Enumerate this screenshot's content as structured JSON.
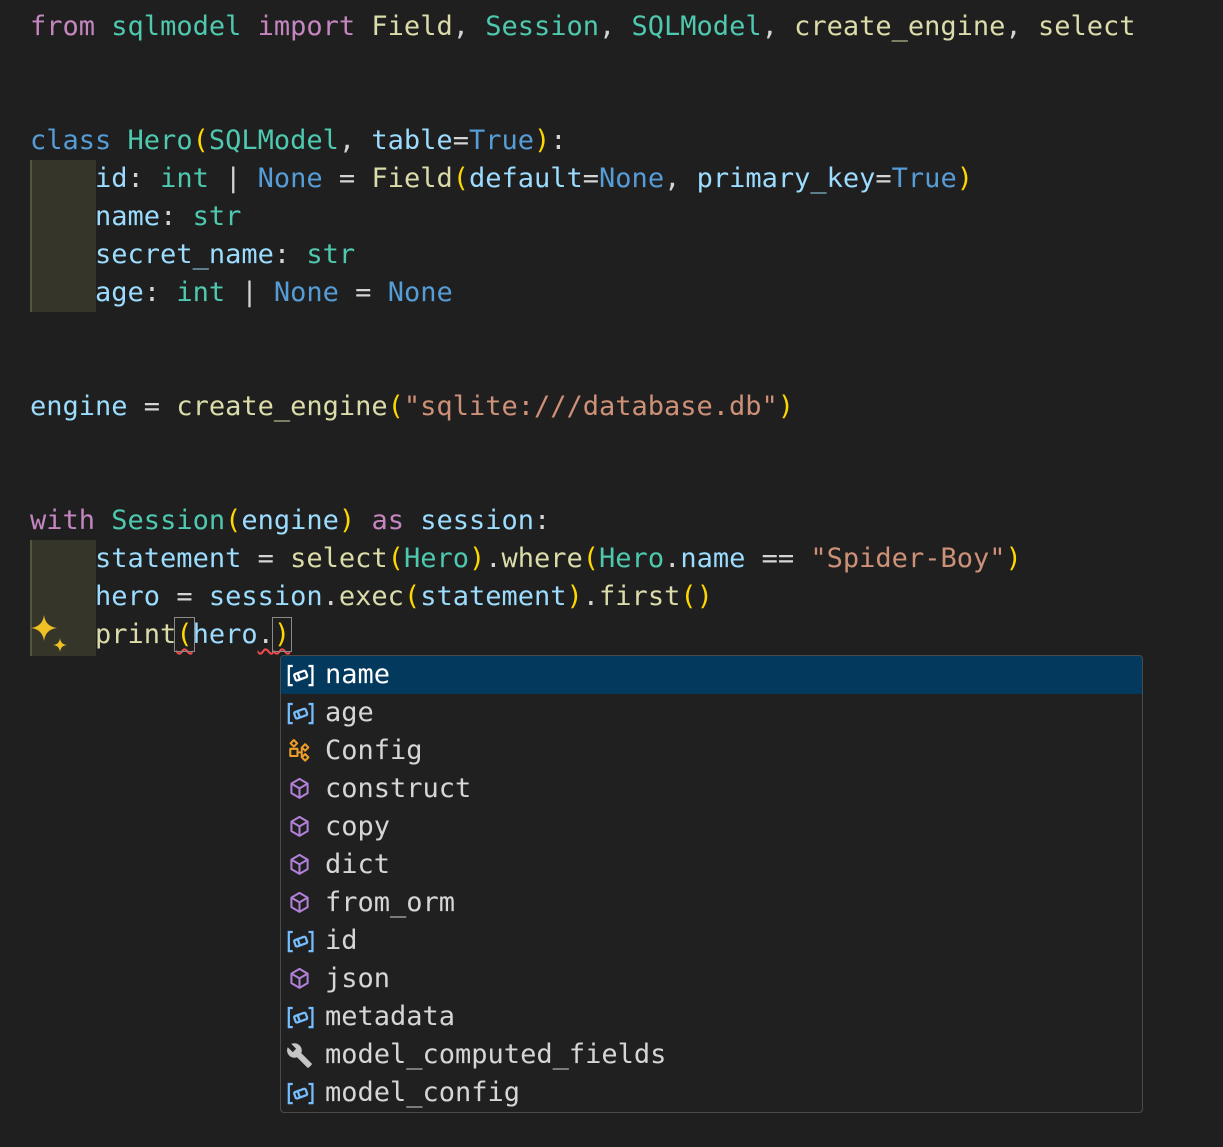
{
  "colors": {
    "editor_bg": "#1F1F1F",
    "kw": "#C586C0",
    "kwb": "#569CD6",
    "cls": "#4EC9B0",
    "fn": "#DCDCAA",
    "var": "#9CDCFE",
    "str": "#CE9178",
    "pl": "#D4D4D4",
    "b1": "#FFD700",
    "error": "#F14C4C",
    "bracket_match": "#8A8A8A",
    "indent_bg": "#36352A",
    "indent_guide": "#57553F",
    "sparkle": "#EFC125",
    "suggest_bg": "#202020",
    "suggest_border": "#4A4A4A",
    "suggest_fg": "#D6D6D6",
    "suggest_selected_bg": "#04395E",
    "suggest_selected_fg": "#FFFFFF",
    "icon_field": "#75BEFF",
    "icon_method": "#B180D7",
    "icon_class": "#EE9D28",
    "icon_property": "#C5C5C5"
  },
  "code": {
    "lines": [
      {
        "tokens": [
          [
            "from",
            "kw"
          ],
          [
            " ",
            "pl"
          ],
          [
            "sqlmodel",
            "cls"
          ],
          [
            " ",
            "pl"
          ],
          [
            "import",
            "kw"
          ],
          [
            " ",
            "pl"
          ],
          [
            "Field",
            "fn"
          ],
          [
            ", ",
            "pl"
          ],
          [
            "Session",
            "cls"
          ],
          [
            ", ",
            "pl"
          ],
          [
            "SQLModel",
            "cls"
          ],
          [
            ", ",
            "pl"
          ],
          [
            "create_engine",
            "fn"
          ],
          [
            ", ",
            "pl"
          ],
          [
            "select",
            "fn"
          ]
        ]
      },
      {
        "tokens": []
      },
      {
        "tokens": []
      },
      {
        "tokens": [
          [
            "class",
            "kwb"
          ],
          [
            " ",
            "pl"
          ],
          [
            "Hero",
            "cls"
          ],
          [
            "(",
            "b1"
          ],
          [
            "SQLModel",
            "cls"
          ],
          [
            ", ",
            "pl"
          ],
          [
            "table",
            "var"
          ],
          [
            "=",
            "pl"
          ],
          [
            "True",
            "kwb"
          ],
          [
            ")",
            "b1"
          ],
          [
            ":",
            "pl"
          ]
        ]
      },
      {
        "tokens": [
          [
            "    ",
            "pl"
          ],
          [
            "id",
            "var"
          ],
          [
            ": ",
            "pl"
          ],
          [
            "int",
            "cls"
          ],
          [
            " | ",
            "pl"
          ],
          [
            "None",
            "kwb"
          ],
          [
            " = ",
            "pl"
          ],
          [
            "Field",
            "fn"
          ],
          [
            "(",
            "b1"
          ],
          [
            "default",
            "var"
          ],
          [
            "=",
            "pl"
          ],
          [
            "None",
            "kwb"
          ],
          [
            ", ",
            "pl"
          ],
          [
            "primary_key",
            "var"
          ],
          [
            "=",
            "pl"
          ],
          [
            "True",
            "kwb"
          ],
          [
            ")",
            "b1"
          ]
        ]
      },
      {
        "tokens": [
          [
            "    ",
            "pl"
          ],
          [
            "name",
            "var"
          ],
          [
            ": ",
            "pl"
          ],
          [
            "str",
            "cls"
          ]
        ]
      },
      {
        "tokens": [
          [
            "    ",
            "pl"
          ],
          [
            "secret_name",
            "var"
          ],
          [
            ": ",
            "pl"
          ],
          [
            "str",
            "cls"
          ]
        ]
      },
      {
        "tokens": [
          [
            "    ",
            "pl"
          ],
          [
            "age",
            "var"
          ],
          [
            ": ",
            "pl"
          ],
          [
            "int",
            "cls"
          ],
          [
            " | ",
            "pl"
          ],
          [
            "None",
            "kwb"
          ],
          [
            " = ",
            "pl"
          ],
          [
            "None",
            "kwb"
          ]
        ]
      },
      {
        "tokens": []
      },
      {
        "tokens": []
      },
      {
        "tokens": [
          [
            "engine",
            "var"
          ],
          [
            " = ",
            "pl"
          ],
          [
            "create_engine",
            "fn"
          ],
          [
            "(",
            "b1"
          ],
          [
            "\"sqlite:///database.db\"",
            "str"
          ],
          [
            ")",
            "b1"
          ]
        ]
      },
      {
        "tokens": []
      },
      {
        "tokens": []
      },
      {
        "tokens": [
          [
            "with",
            "kw"
          ],
          [
            " ",
            "pl"
          ],
          [
            "Session",
            "cls"
          ],
          [
            "(",
            "b1"
          ],
          [
            "engine",
            "var"
          ],
          [
            ")",
            "b1"
          ],
          [
            " ",
            "pl"
          ],
          [
            "as",
            "kw"
          ],
          [
            " ",
            "pl"
          ],
          [
            "session",
            "var"
          ],
          [
            ":",
            "pl"
          ]
        ]
      },
      {
        "tokens": [
          [
            "    ",
            "pl"
          ],
          [
            "statement",
            "var"
          ],
          [
            " = ",
            "pl"
          ],
          [
            "select",
            "fn"
          ],
          [
            "(",
            "b1"
          ],
          [
            "Hero",
            "cls"
          ],
          [
            ")",
            "b1"
          ],
          [
            ".",
            "pl"
          ],
          [
            "where",
            "fn"
          ],
          [
            "(",
            "b1"
          ],
          [
            "Hero",
            "cls"
          ],
          [
            ".",
            "pl"
          ],
          [
            "name",
            "var"
          ],
          [
            " == ",
            "pl"
          ],
          [
            "\"Spider-Boy\"",
            "str"
          ],
          [
            ")",
            "b1"
          ]
        ]
      },
      {
        "tokens": [
          [
            "    ",
            "pl"
          ],
          [
            "hero",
            "var"
          ],
          [
            " = ",
            "pl"
          ],
          [
            "session",
            "var"
          ],
          [
            ".",
            "pl"
          ],
          [
            "exec",
            "fn"
          ],
          [
            "(",
            "b1"
          ],
          [
            "statement",
            "var"
          ],
          [
            ")",
            "b1"
          ],
          [
            ".",
            "pl"
          ],
          [
            "first",
            "fn"
          ],
          [
            "(",
            "b1"
          ],
          [
            ")",
            "b1"
          ]
        ]
      },
      {
        "tokens": [
          [
            "    ",
            "pl"
          ],
          [
            "print",
            "fn"
          ],
          [
            "(",
            "b1",
            "me"
          ],
          [
            "hero",
            "var"
          ],
          [
            ".",
            "pl",
            "e"
          ],
          [
            ")",
            "b1",
            "me"
          ]
        ]
      }
    ]
  },
  "suggest": {
    "items": [
      {
        "label": "name",
        "kind": "field",
        "selected": true
      },
      {
        "label": "age",
        "kind": "field",
        "selected": false
      },
      {
        "label": "Config",
        "kind": "class",
        "selected": false
      },
      {
        "label": "construct",
        "kind": "method",
        "selected": false
      },
      {
        "label": "copy",
        "kind": "method",
        "selected": false
      },
      {
        "label": "dict",
        "kind": "method",
        "selected": false
      },
      {
        "label": "from_orm",
        "kind": "method",
        "selected": false
      },
      {
        "label": "id",
        "kind": "field",
        "selected": false
      },
      {
        "label": "json",
        "kind": "method",
        "selected": false
      },
      {
        "label": "metadata",
        "kind": "field",
        "selected": false
      },
      {
        "label": "model_computed_fields",
        "kind": "property",
        "selected": false
      },
      {
        "label": "model_config",
        "kind": "field",
        "selected": false
      }
    ]
  }
}
